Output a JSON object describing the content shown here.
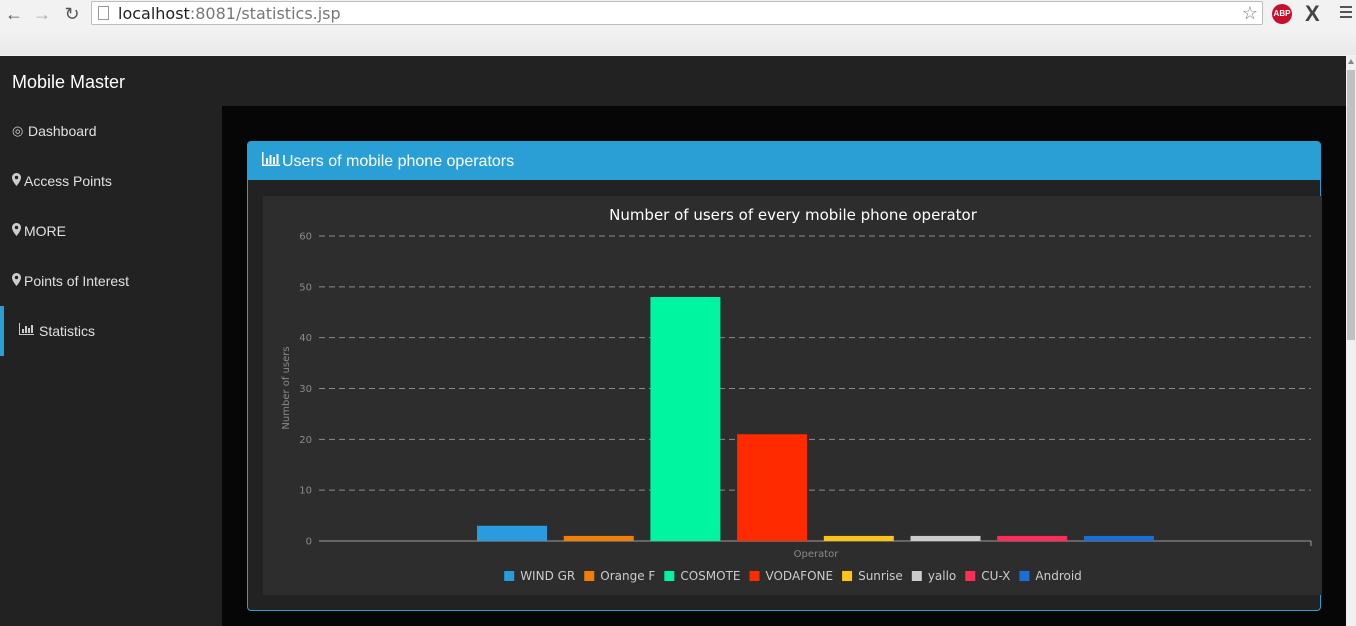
{
  "browser": {
    "url_host": "localhost",
    "url_rest": ":8081/statistics.jsp",
    "abp_label": "ABP"
  },
  "app": {
    "brand": "Mobile Master"
  },
  "sidebar": {
    "items": [
      {
        "label": "Dashboard",
        "icon": "target-icon"
      },
      {
        "label": "Access Points",
        "icon": "map-marker-icon"
      },
      {
        "label": "MORE",
        "icon": "map-marker-icon"
      },
      {
        "label": "Points of Interest",
        "icon": "map-marker-icon"
      },
      {
        "label": "Statistics",
        "icon": "bar-chart-icon",
        "active": true
      }
    ]
  },
  "panel": {
    "title": "Users of mobile phone operators"
  },
  "chart_data": {
    "type": "bar",
    "title": "Number of users of every mobile phone operator",
    "xlabel": "Operator",
    "ylabel": "Number of users",
    "ylim": [
      0,
      60
    ],
    "yticks": [
      0,
      10,
      20,
      30,
      40,
      50,
      60
    ],
    "grid": true,
    "legend_position": "bottom",
    "series": [
      {
        "name": "WIND GR",
        "value": 3,
        "color": "#2b9be0"
      },
      {
        "name": "Orange F",
        "value": 1,
        "color": "#f07f0a"
      },
      {
        "name": "COSMOTE",
        "value": 48,
        "color": "#00f5a0"
      },
      {
        "name": "VODAFONE",
        "value": 21,
        "color": "#ff2a00"
      },
      {
        "name": "Sunrise",
        "value": 1,
        "color": "#fcc419"
      },
      {
        "name": "yallo",
        "value": 1,
        "color": "#cccccc"
      },
      {
        "name": "CU-X",
        "value": 1,
        "color": "#ff2c5a"
      },
      {
        "name": "Android",
        "value": 1,
        "color": "#1a6fd6"
      }
    ]
  }
}
